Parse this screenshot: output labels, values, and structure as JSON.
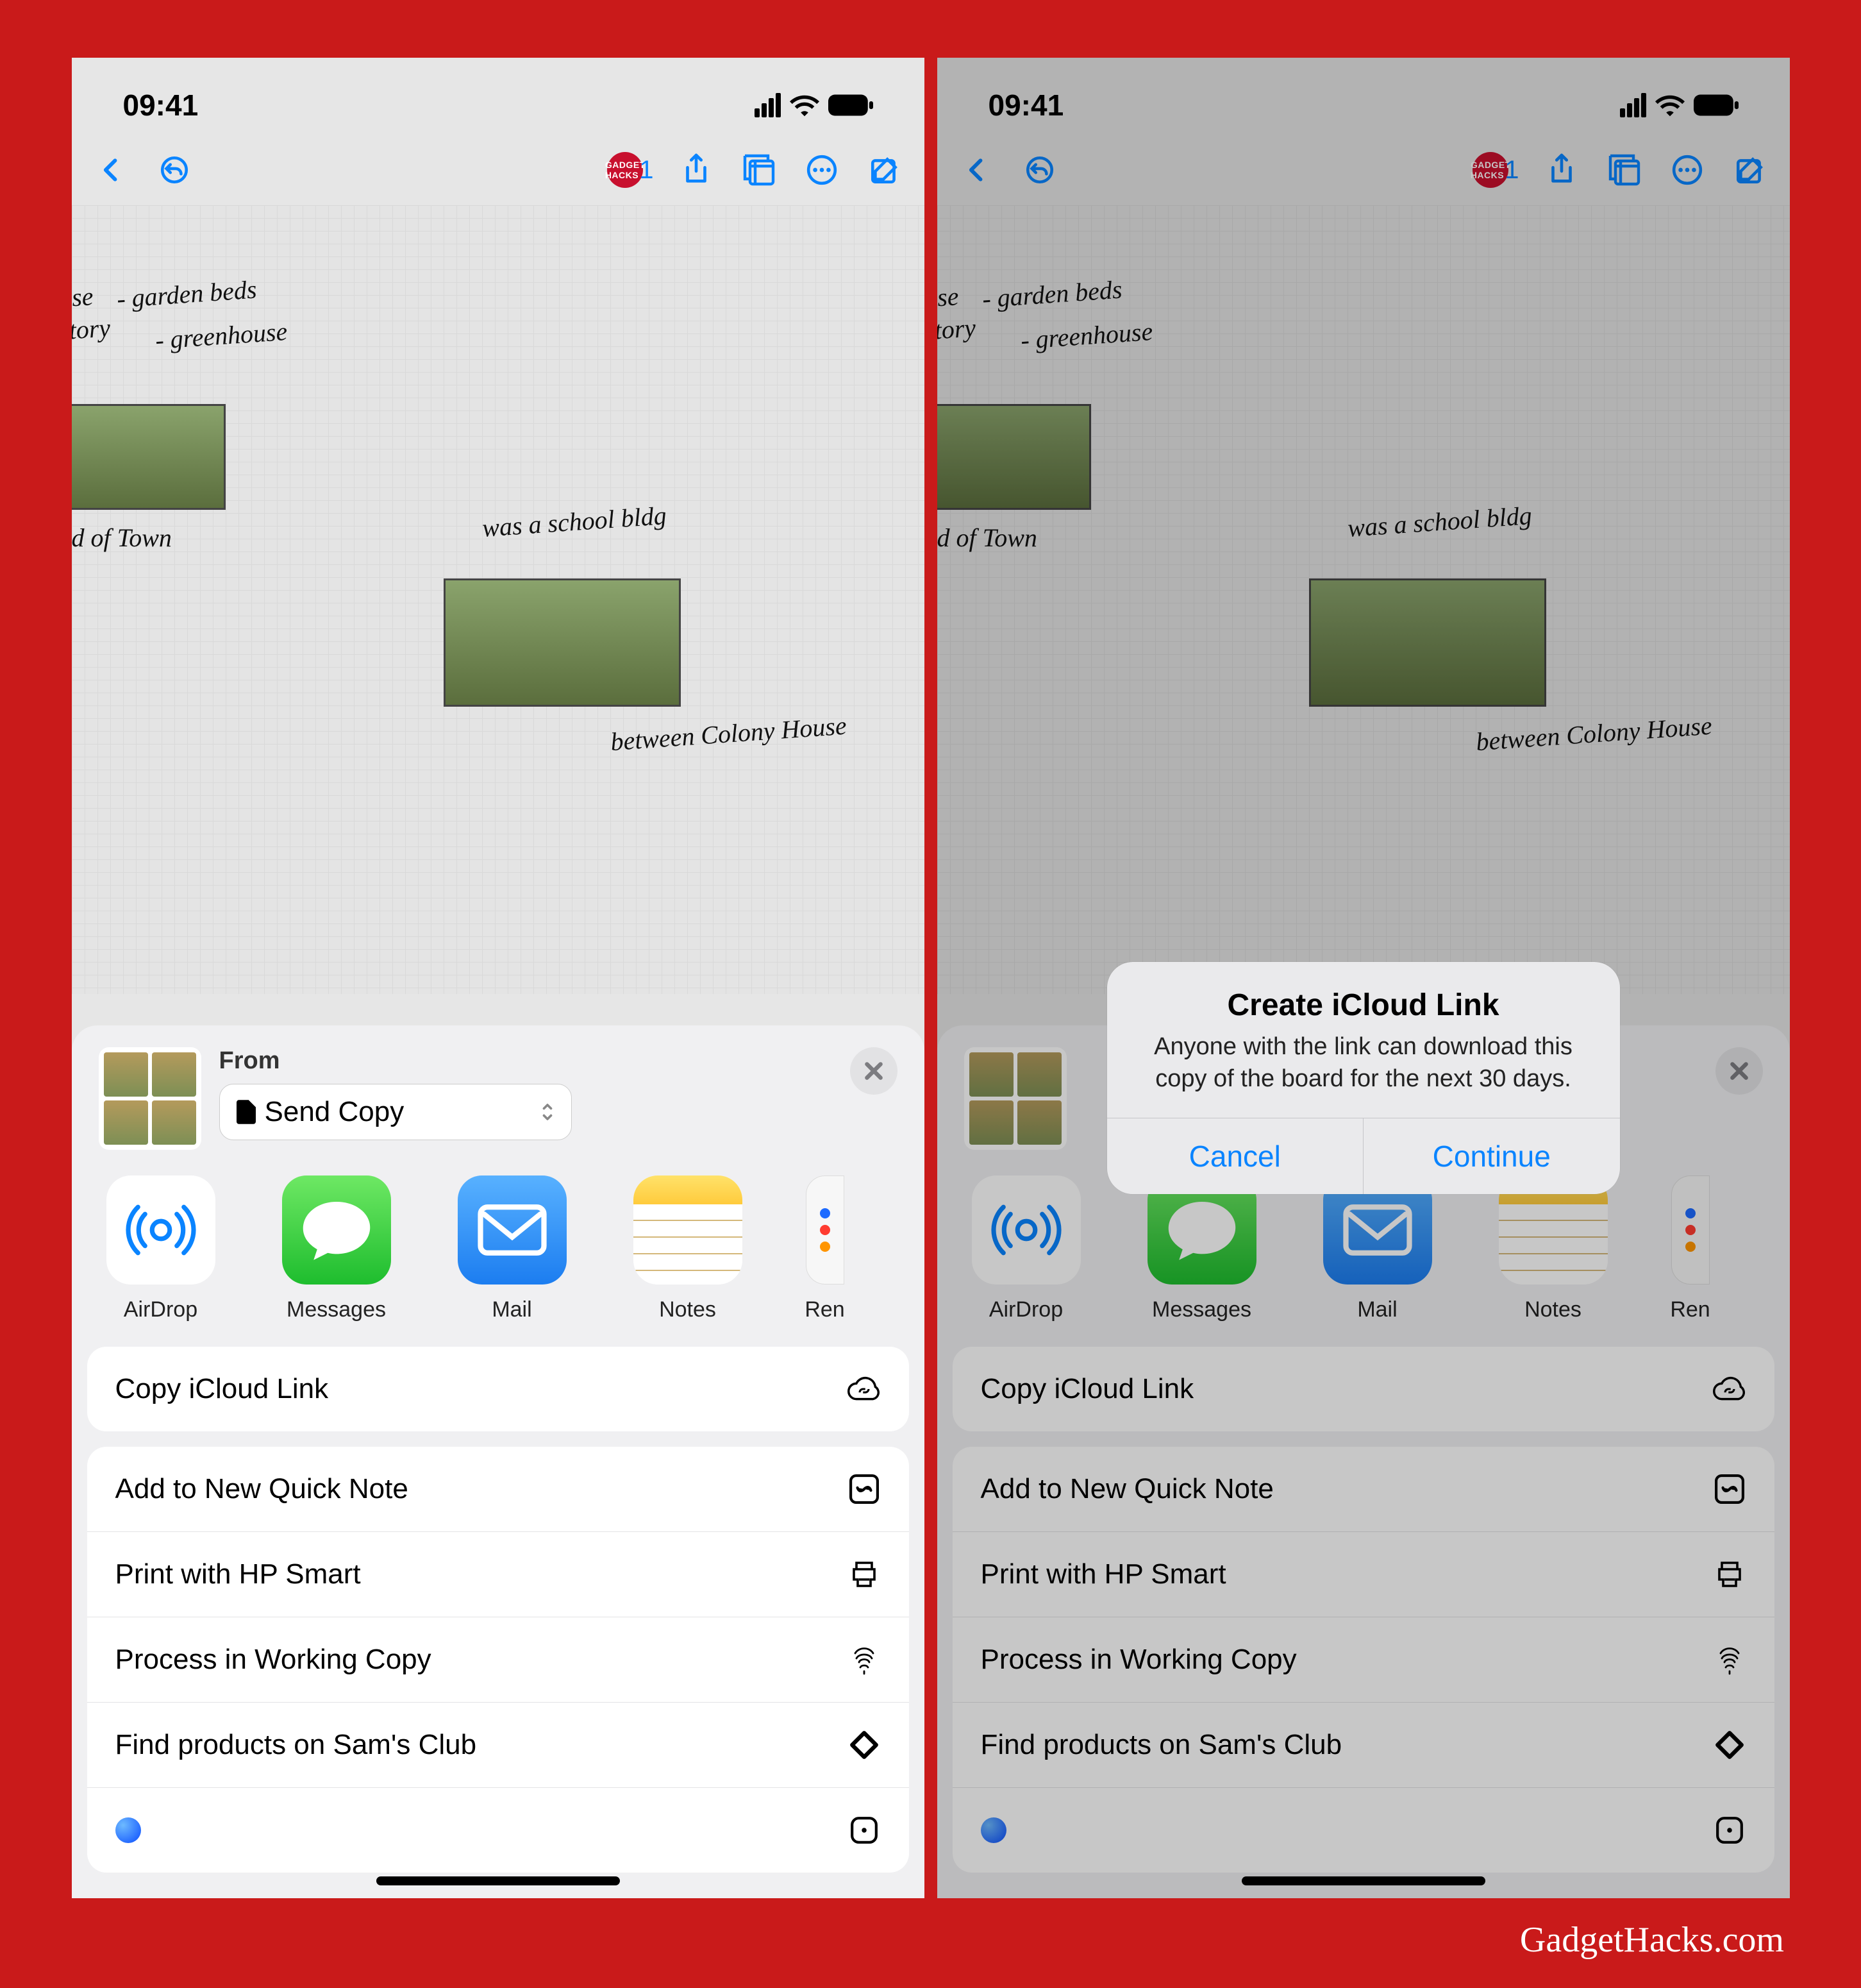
{
  "status": {
    "time": "09:41"
  },
  "toolbar": {
    "badge_count": "1",
    "badge_text": "GADGET HACKS"
  },
  "canvas": {
    "notes": [
      "use",
      "story",
      "- garden beds",
      "- greenhouse",
      "nd of Town",
      "was a school bldg",
      "between Colony House"
    ]
  },
  "sheet": {
    "from_label": "From",
    "picker_value": "Send Copy",
    "apps": [
      {
        "name": "AirDrop"
      },
      {
        "name": "Messages"
      },
      {
        "name": "Mail"
      },
      {
        "name": "Notes"
      },
      {
        "name": "Ren"
      }
    ],
    "action_primary": "Copy iCloud Link",
    "actions": [
      "Add to New Quick Note",
      "Print with HP Smart",
      "Process in Working Copy",
      "Find products on Sam's Club"
    ]
  },
  "alert": {
    "title": "Create iCloud Link",
    "message": "Anyone with the link can download this copy of the board for the next 30 days.",
    "cancel": "Cancel",
    "continue": "Continue"
  },
  "credit": "GadgetHacks.com"
}
